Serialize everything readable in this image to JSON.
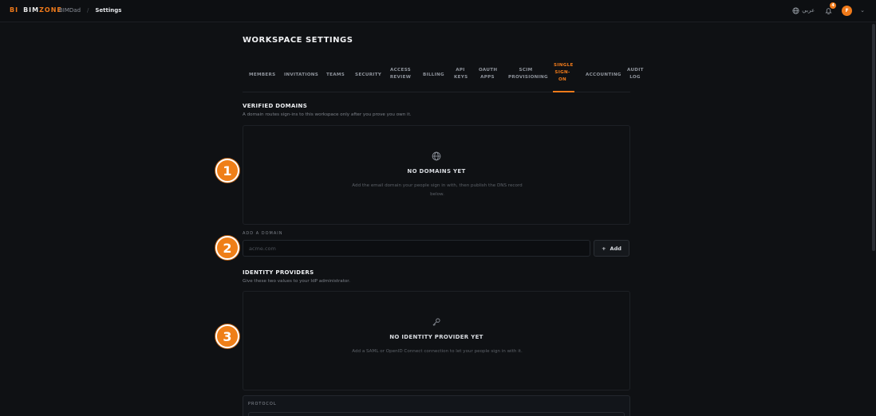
{
  "brand": {
    "mark": "BI",
    "name_a": "BIM",
    "name_b": "ZONE"
  },
  "breadcrumb": {
    "item1": "BIMDad",
    "sep": "/",
    "current": "Settings"
  },
  "topbar": {
    "language": "عربي",
    "notification_count": "4",
    "avatar_initial": "F"
  },
  "page": {
    "title": "WORKSPACE SETTINGS"
  },
  "tabs": [
    {
      "label": "MEMBERS"
    },
    {
      "label": "INVITATIONS"
    },
    {
      "label": "TEAMS"
    },
    {
      "label": "SECURITY"
    },
    {
      "label": "ACCESS REVIEW"
    },
    {
      "label": "BILLING"
    },
    {
      "label": "API KEYS"
    },
    {
      "label": "OAUTH APPS"
    },
    {
      "label": "SCIM PROVISIONING"
    },
    {
      "label": "SINGLE SIGN-ON"
    },
    {
      "label": "ACCOUNTING"
    },
    {
      "label": "AUDIT LOG"
    }
  ],
  "verified_domains": {
    "title": "VERIFIED DOMAINS",
    "subtitle": "A domain routes sign-ins to this workspace only after you prove you own it.",
    "empty_title": "NO DOMAINS YET",
    "empty_desc": "Add the email domain your people sign in with, then publish the DNS record below."
  },
  "add_domain": {
    "label": "ADD A DOMAIN",
    "placeholder": "acme.com",
    "button": "Add"
  },
  "identity_providers": {
    "title": "IDENTITY PROVIDERS",
    "subtitle": "Give these two values to your IdP administrator.",
    "empty_title": "NO IDENTITY PROVIDER YET",
    "empty_desc": "Add a SAML or OpenID Connect connection to let your people sign in with it."
  },
  "protocol": {
    "label": "PROTOCOL"
  },
  "markers": [
    "1",
    "2",
    "3"
  ],
  "colors": {
    "accent": "#f07a1a",
    "background": "#0f1114"
  }
}
